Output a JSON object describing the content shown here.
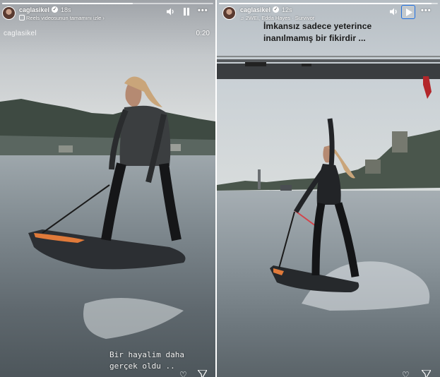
{
  "left_story": {
    "username": "caglasikel",
    "time_ago": "18s",
    "subline": "Reels videosunun tamamını izle",
    "watermark": "caglasikel",
    "duration": "0:20",
    "caption_line1": "Bir hayalim daha",
    "caption_line2": "gerçek oldu ..",
    "progress": 0.62,
    "controls": {
      "volume": "volume-icon",
      "pause": "pause-icon",
      "more": "more-icon"
    }
  },
  "right_story": {
    "username": "caglasikel",
    "time_ago": "12s",
    "music": "2WEI, Edda Hayes · Survivor",
    "caption_line1": "İmkansız sadece yeterince",
    "caption_line2": "inanılmamış bir fikirdir ...",
    "progress": 0.97,
    "controls": {
      "volume": "volume-icon",
      "play": "play-icon",
      "more": "more-icon"
    }
  },
  "colors": {
    "play_button_border": "#1f6fe0"
  }
}
